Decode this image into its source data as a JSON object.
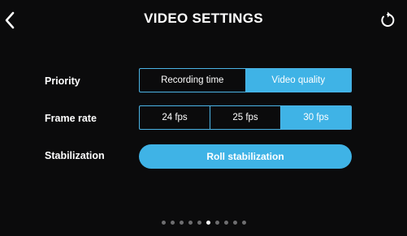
{
  "header": {
    "title": "VIDEO SETTINGS",
    "back_icon": "chevron-left-icon",
    "reset_icon": "reset-icon"
  },
  "priority": {
    "label": "Priority",
    "options": [
      "Recording time",
      "Video quality"
    ],
    "selected": "Video quality"
  },
  "frame_rate": {
    "label": "Frame rate",
    "options": [
      "24 fps",
      "25 fps",
      "30 fps"
    ],
    "selected": "30 fps"
  },
  "stabilization": {
    "label": "Stabilization",
    "value": "Roll stabilization"
  },
  "pager": {
    "count": 10,
    "active_index": 5
  },
  "colors": {
    "accent": "#3fb3e6",
    "background": "#0b0b0c"
  }
}
